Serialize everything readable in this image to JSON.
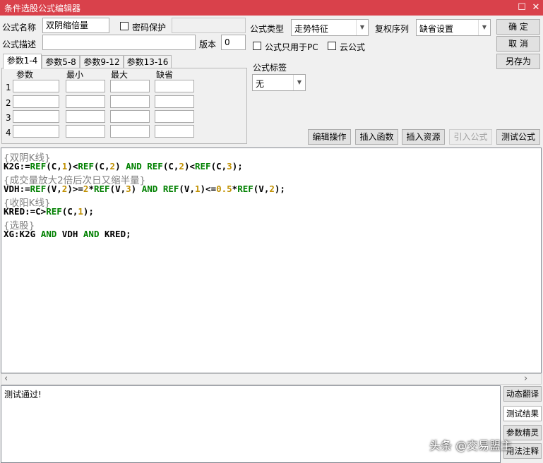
{
  "window": {
    "title": "条件选股公式编辑器",
    "maximize_glyph": "☐",
    "close_glyph": "✕"
  },
  "form": {
    "name_label": "公式名称",
    "name_value": "双阴缩倍量",
    "password_label": "密码保护",
    "password_checked": false,
    "desc_label": "公式描述",
    "desc_value": "",
    "version_label": "版本",
    "version_value": "0",
    "type_label": "公式类型",
    "type_value": "走势特征",
    "rights_label": "复权序列",
    "rights_value": "缺省设置",
    "pc_only_label": "公式只用于PC",
    "pc_only_checked": false,
    "cloud_label": "云公式",
    "cloud_checked": false,
    "tag_label": "公式标签",
    "tag_value": "无"
  },
  "buttons": {
    "ok": "确  定",
    "cancel": "取  消",
    "save_as": "另存为",
    "edit_ops": "编辑操作",
    "insert_func": "插入函数",
    "insert_res": "插入资源",
    "import": "引入公式",
    "test": "测试公式"
  },
  "tabs": [
    "参数1-4",
    "参数5-8",
    "参数9-12",
    "参数13-16"
  ],
  "param_table": {
    "headers": [
      "参数",
      "最小",
      "最大",
      "缺省"
    ],
    "rows": [
      "1",
      "2",
      "3",
      "4"
    ]
  },
  "editor_lines": [
    {
      "kind": "comment",
      "text": "{双阴K线}"
    },
    {
      "kind": "code",
      "tokens": [
        [
          "K2G:=",
          ""
        ],
        [
          "REF",
          "fn"
        ],
        [
          "(C,",
          ""
        ],
        [
          "1",
          "num"
        ],
        [
          ")<",
          ""
        ],
        [
          "REF",
          "fn"
        ],
        [
          "(C,",
          ""
        ],
        [
          "2",
          "num"
        ],
        [
          ") ",
          ""
        ],
        [
          "AND",
          "fn"
        ],
        [
          " ",
          ""
        ],
        [
          "REF",
          "fn"
        ],
        [
          "(C,",
          ""
        ],
        [
          "2",
          "num"
        ],
        [
          ")<",
          ""
        ],
        [
          "REF",
          "fn"
        ],
        [
          "(C,",
          ""
        ],
        [
          "3",
          "num"
        ],
        [
          ");",
          ""
        ]
      ]
    },
    {
      "kind": "comment",
      "text": "{成交量放大2倍后次日又缩半量}"
    },
    {
      "kind": "code",
      "tokens": [
        [
          "VDH:=",
          ""
        ],
        [
          "REF",
          "fn"
        ],
        [
          "(V,",
          ""
        ],
        [
          "2",
          "num"
        ],
        [
          ")>=",
          ""
        ],
        [
          "2",
          "num"
        ],
        [
          "*",
          ""
        ],
        [
          "REF",
          "fn"
        ],
        [
          "(V,",
          ""
        ],
        [
          "3",
          "num"
        ],
        [
          ") ",
          ""
        ],
        [
          "AND",
          "fn"
        ],
        [
          " ",
          ""
        ],
        [
          "REF",
          "fn"
        ],
        [
          "(V,",
          ""
        ],
        [
          "1",
          "num"
        ],
        [
          ")<=",
          ""
        ],
        [
          "0.5",
          "num"
        ],
        [
          "*",
          ""
        ],
        [
          "REF",
          "fn"
        ],
        [
          "(V,",
          ""
        ],
        [
          "2",
          "num"
        ],
        [
          ");",
          ""
        ]
      ]
    },
    {
      "kind": "comment",
      "text": "{收阳K线}"
    },
    {
      "kind": "code",
      "tokens": [
        [
          "KRED:=C>",
          ""
        ],
        [
          "REF",
          "fn"
        ],
        [
          "(C,",
          ""
        ],
        [
          "1",
          "num"
        ],
        [
          ");",
          ""
        ]
      ]
    },
    {
      "kind": "comment",
      "text": "{选股}"
    },
    {
      "kind": "code",
      "tokens": [
        [
          "XG:K2G ",
          ""
        ],
        [
          "AND",
          "fn"
        ],
        [
          " VDH ",
          ""
        ],
        [
          "AND",
          "fn"
        ],
        [
          " KRED;",
          ""
        ]
      ]
    }
  ],
  "scroll": {
    "left_glyph": "‹",
    "right_glyph": "›"
  },
  "output": {
    "text": "测试通过!"
  },
  "side_buttons": [
    "动态翻译",
    "测试结果",
    "参数精灵",
    "用法注释"
  ],
  "watermark": "头条 @交易盟主"
}
